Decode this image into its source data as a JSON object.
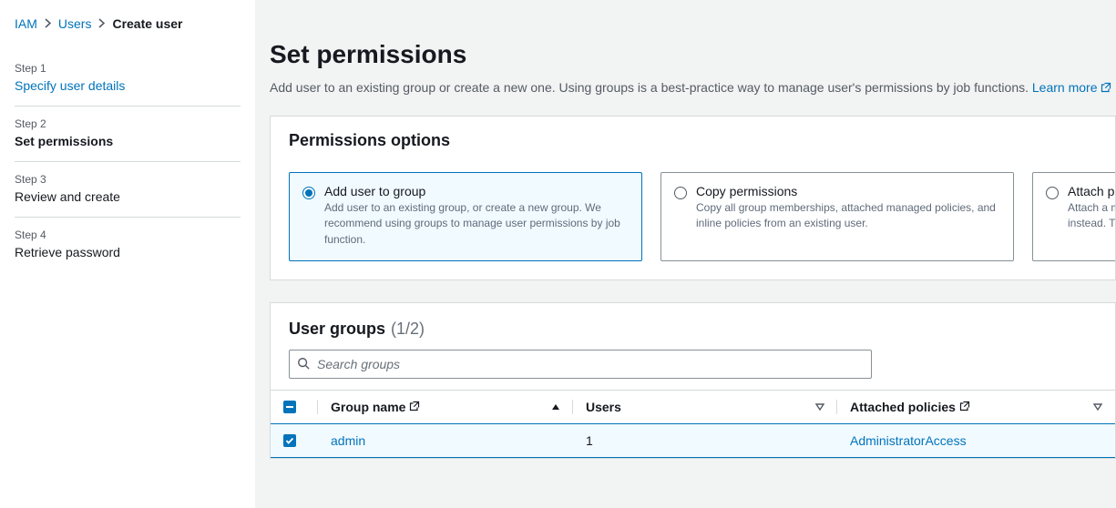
{
  "breadcrumb": {
    "items": [
      {
        "label": "IAM",
        "link": true
      },
      {
        "label": "Users",
        "link": true
      },
      {
        "label": "Create user",
        "link": false
      }
    ]
  },
  "steps": [
    {
      "num": "Step 1",
      "title": "Specify user details",
      "link": true,
      "active": false
    },
    {
      "num": "Step 2",
      "title": "Set permissions",
      "link": false,
      "active": true
    },
    {
      "num": "Step 3",
      "title": "Review and create",
      "link": false,
      "active": false
    },
    {
      "num": "Step 4",
      "title": "Retrieve password",
      "link": false,
      "active": false
    }
  ],
  "header": {
    "title": "Set permissions",
    "description": "Add user to an existing group or create a new one. Using groups is a best-practice way to manage user's permissions by job functions.",
    "learn_more": "Learn more"
  },
  "options_panel": {
    "title": "Permissions options",
    "options": [
      {
        "title": "Add user to group",
        "desc": "Add user to an existing group, or create a new group. We recommend using groups to manage user permissions by job function.",
        "selected": true
      },
      {
        "title": "Copy permissions",
        "desc": "Copy all group memberships, attached managed policies, and inline policies from an existing user.",
        "selected": false
      },
      {
        "title": "Attach po",
        "desc": "Attach a m\npractice, we\ninstead. Th",
        "selected": false
      }
    ]
  },
  "groups_panel": {
    "title": "User groups",
    "count": "(1/2)",
    "search_placeholder": "Search groups",
    "columns": {
      "name": "Group name",
      "users": "Users",
      "policies": "Attached policies"
    },
    "rows": [
      {
        "name": "admin",
        "users": "1",
        "policies": "AdministratorAccess",
        "selected": true
      }
    ]
  }
}
